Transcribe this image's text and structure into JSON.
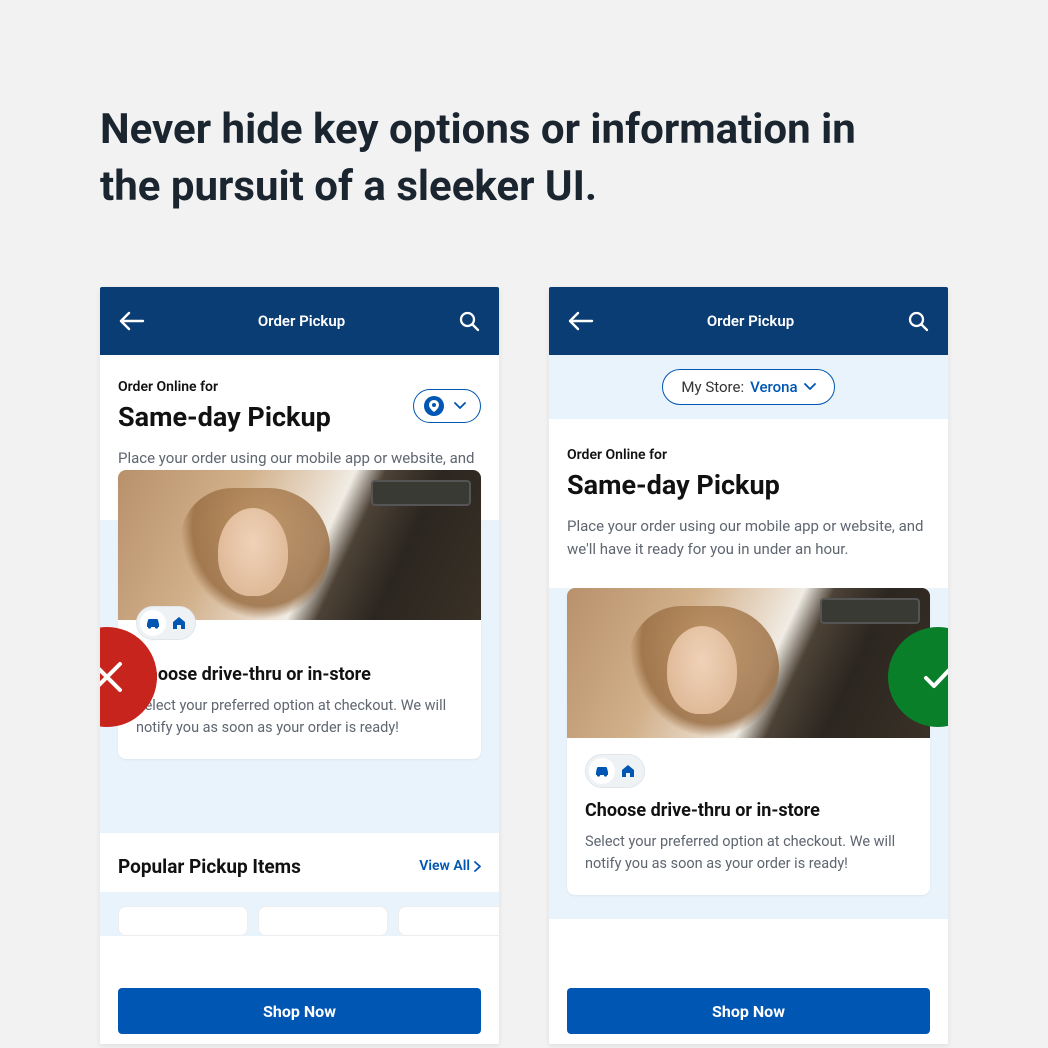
{
  "heading": "Never hide key options or information in the pursuit of a sleeker UI.",
  "topbar": {
    "title": "Order Pickup"
  },
  "storeSelector": {
    "label": "My Store:",
    "store": "Verona"
  },
  "intro": {
    "eyebrow": "Order Online for",
    "title": "Same-day Pickup",
    "description": "Place your order using our mobile app or website, and we'll have it ready for you in under an hour."
  },
  "infoCard": {
    "heading": "Choose drive-thru or in-store",
    "text": "Select your preferred option at checkout. We will notify you as soon as your order is ready!"
  },
  "popular": {
    "title": "Popular Pickup Items",
    "viewAll": "View All"
  },
  "cta": "Shop Now"
}
